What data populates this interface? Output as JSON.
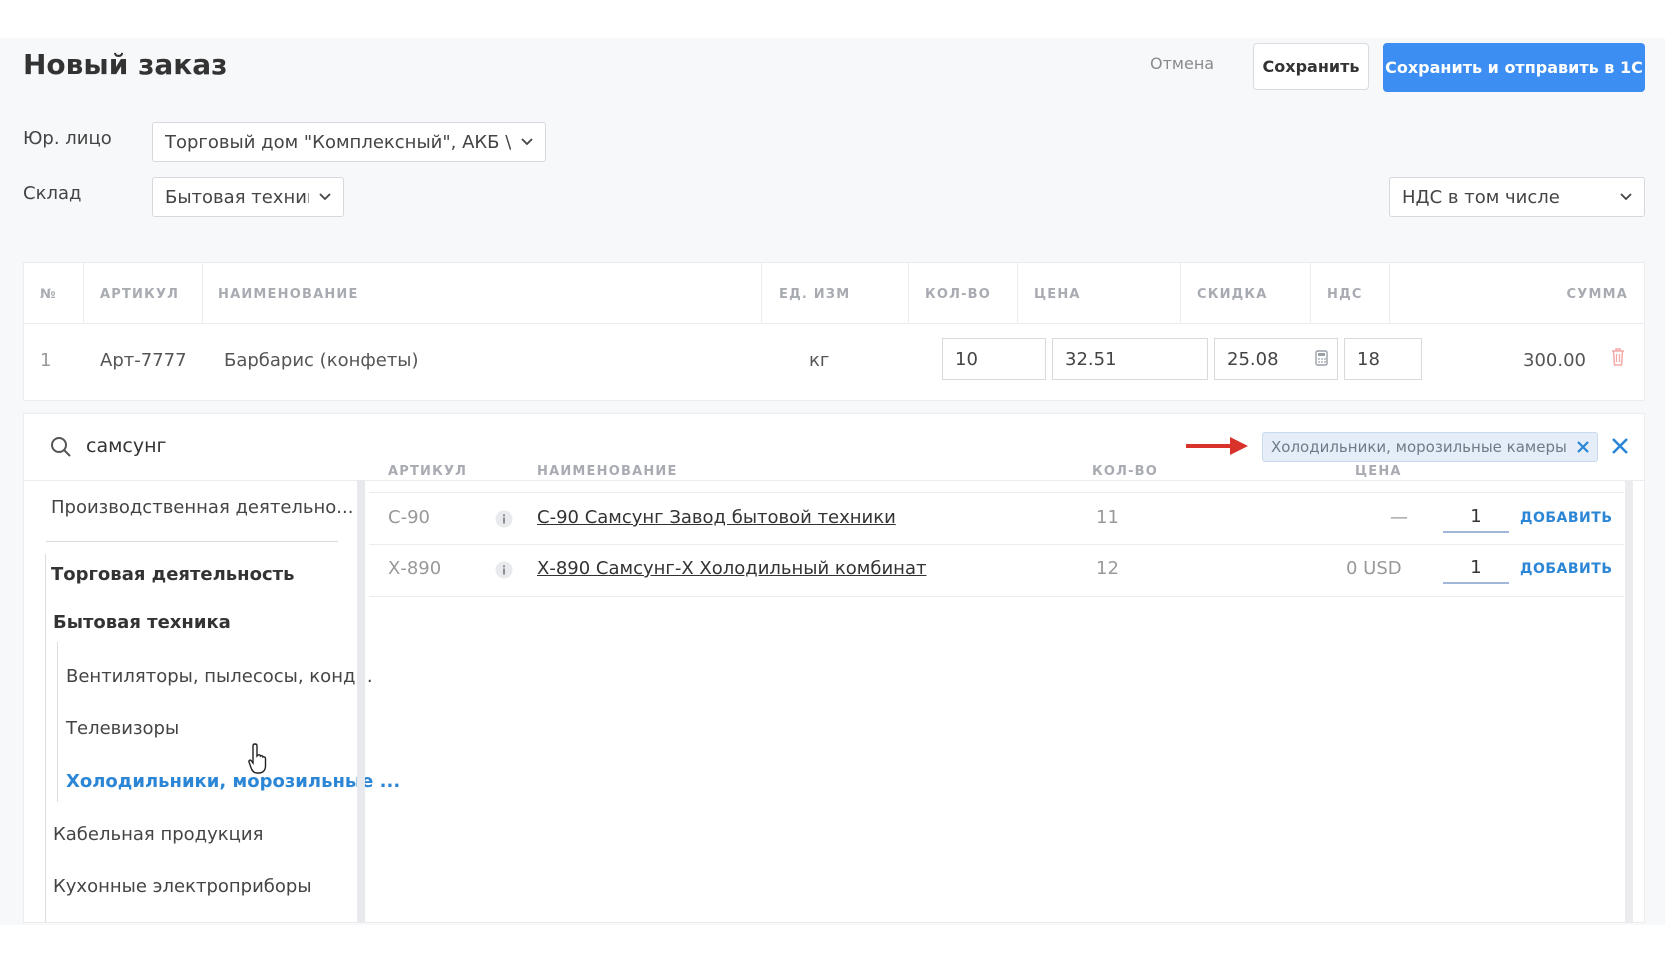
{
  "header": {
    "title": "Новый заказ",
    "cancel_label": "Отмена",
    "save_label": "Сохранить",
    "save_send_label": "Сохранить и отправить в 1С"
  },
  "form": {
    "legal_label": "Юр. лицо",
    "legal_value": "Торговый дом \"Комплексный\", АКБ \\\"В...",
    "warehouse_label": "Склад",
    "warehouse_value": "Бытовая техника",
    "vat_mode": "НДС в том числе"
  },
  "order_table": {
    "headers": [
      "№",
      "АРТИКУЛ",
      "НАИМЕНОВАНИЕ",
      "ЕД. ИЗМ",
      "КОЛ-ВО",
      "ЦЕНА",
      "СКИДКА",
      "НДС",
      "СУММА"
    ],
    "rows": [
      {
        "num": "1",
        "article": "Арт-7777",
        "name": "Барбарис (конфеты)",
        "unit": "кг",
        "qty": "10",
        "price": "32.51",
        "discount": "25.08",
        "vat": "18",
        "sum": "300.00"
      }
    ]
  },
  "search": {
    "query": "самсунг",
    "filter_chip": "Холодильники, морозильные камеры"
  },
  "categories": {
    "production": "Производственная деятельно...",
    "trade": "Торговая деятельность",
    "appliances": "Бытовая техника",
    "fans": "Вентиляторы, пылесосы, конд...",
    "tv": "Телевизоры",
    "fridges": "Холодильники, морозильные ...",
    "cables": "Кабельная продукция",
    "kitchen": "Кухонные электроприборы"
  },
  "results": {
    "headers": [
      "АРТИКУЛ",
      "НАИМЕНОВАНИЕ",
      "КОЛ-ВО",
      "ЦЕНА"
    ],
    "add_label": "ДОБАВИТЬ",
    "rows": [
      {
        "article": "С-90",
        "name": "С-90 Самсунг Завод бытовой техники",
        "stock": "11",
        "price": "—",
        "qty": "1"
      },
      {
        "article": "Х-890",
        "name": "Х-890 Самсунг-Х Холодильный комбинат",
        "stock": "12",
        "price": "0 USD",
        "qty": "1"
      }
    ]
  },
  "colors": {
    "primary": "#3d8ef2",
    "link": "#2c86d6",
    "arrow": "#d9322a",
    "delete_icon": "#f4a9a9"
  },
  "icons": [
    "chevron-down-icon",
    "trash-icon",
    "calculator-icon",
    "search-icon",
    "arrow-right-icon",
    "close-icon",
    "info-icon",
    "cursor-hand-icon"
  ]
}
